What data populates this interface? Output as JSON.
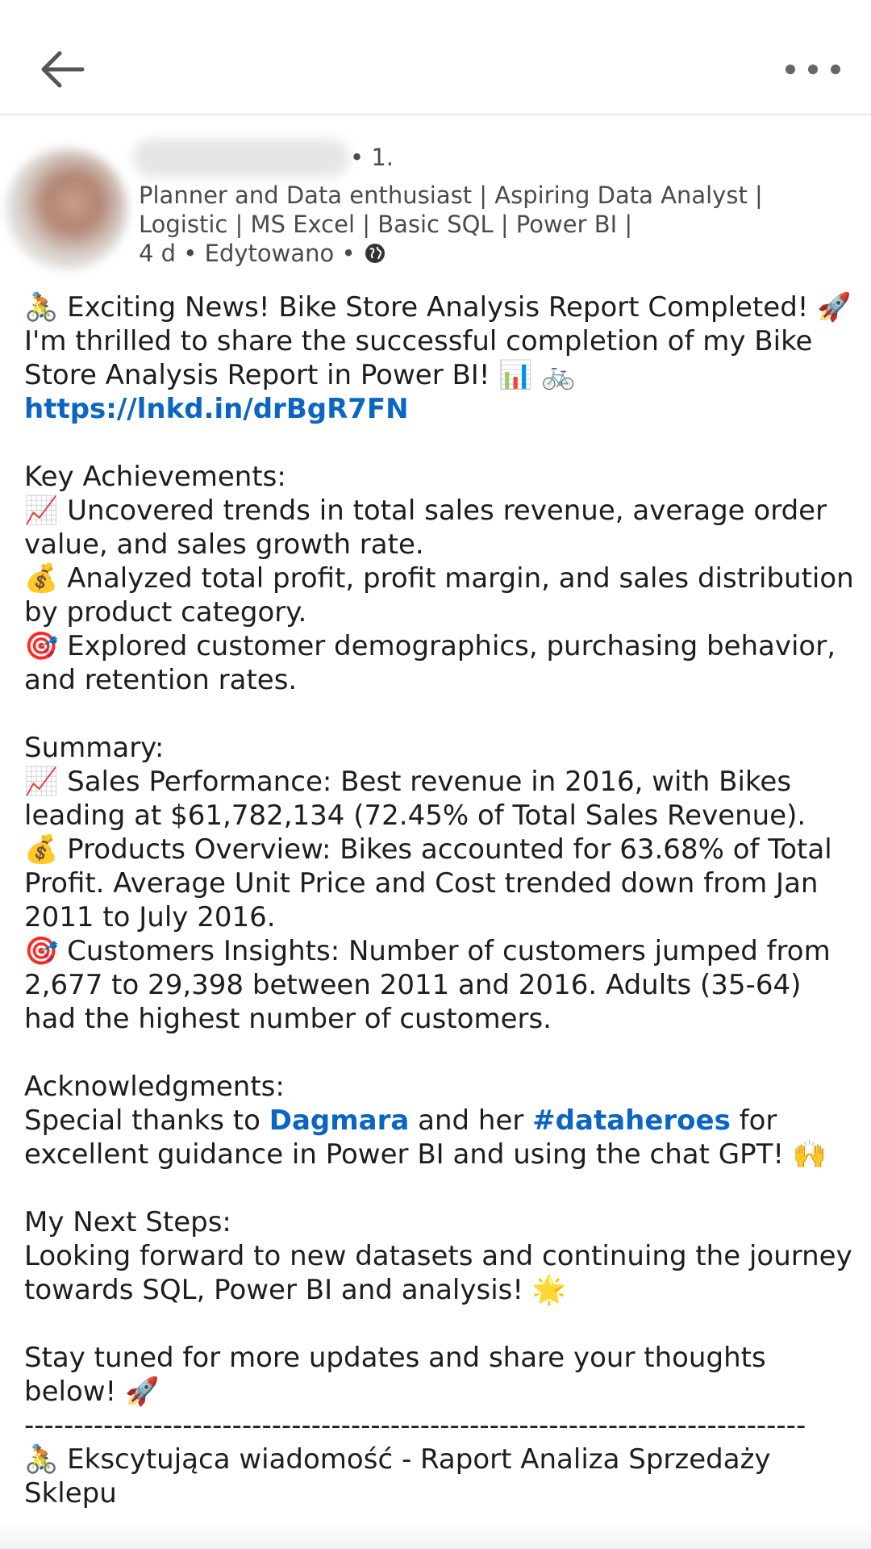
{
  "nav": {
    "back_icon": "arrow-left-icon",
    "more_icon": "more-horizontal-icon"
  },
  "author": {
    "degree": "• 1.",
    "headline": "Planner and Data enthusiast | Aspiring Data Analyst | Logistic | MS Excel | Basic SQL | Power BI |",
    "meta": "4 d • Edytowano •",
    "visibility_icon": "globe-icon"
  },
  "post": {
    "l1": "🚴 Exciting News! Bike Store Analysis Report Completed! 🚀",
    "l2": "I'm thrilled to share the successful completion of my Bike Store Analysis Report in Power BI! 📊 🚲 ",
    "link": "https://lnkd.in/drBgR7FN",
    "key_heading": "Key Achievements:",
    "key1": "📈 Uncovered trends in total sales revenue, average order value, and sales growth rate.",
    "key2": "💰 Analyzed total profit, profit margin, and sales distribution by product category.",
    "key3": "🎯 Explored customer demographics, purchasing behavior, and retention rates.",
    "summary_heading": "Summary:",
    "sum1": "📈 Sales Performance: Best revenue in 2016, with Bikes leading at $61,782,134 (72.45% of Total Sales Revenue).",
    "sum2": "💰 Products Overview: Bikes accounted for 63.68% of Total Profit. Average Unit Price and Cost trended down from Jan 2011 to July 2016.",
    "sum3": "🎯 Customers Insights: Number of customers jumped from 2,677 to 29,398 between 2011 and 2016. Adults (35-64) had the highest number of customers.",
    "ack_heading": "Acknowledgments:",
    "ack_pre": "Special thanks to ",
    "ack_mention": "Dagmara",
    "ack_mid": " and her ",
    "ack_hashtag": "#dataheroes",
    "ack_post": " for excellent guidance in Power BI and using the chat GPT! 🙌",
    "next_heading": "My Next Steps:",
    "next_body": "Looking forward to new datasets and continuing the journey towards SQL, Power BI and analysis! 🌟",
    "stay": "Stay tuned for more updates and share your thoughts below! 🚀",
    "divider": "-------------------------------------------------------------------------------",
    "pl1": "🚴 Ekscytująca wiadomość - Raport Analiza Sprzedaży Sklepu"
  },
  "colors": {
    "link": "#0a66c2",
    "text": "#1d1d1d",
    "muted": "#4b4b4b"
  }
}
